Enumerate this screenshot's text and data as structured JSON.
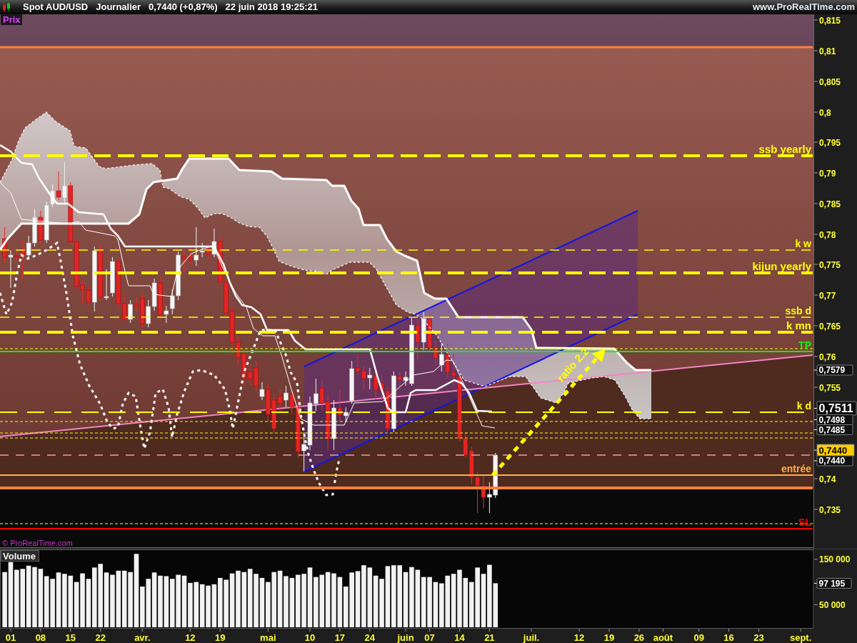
{
  "header": {
    "symbol": "Spot AUD/USD",
    "period": "Journalier",
    "quote": "0,7440 (+0,87%)",
    "timestamp": "22 juin 2018 19:25:21",
    "site": "www.ProRealTime.com"
  },
  "price_panel": {
    "title": "Prix",
    "copyright": "© ProRealTime.com",
    "arrow_label": "ratio 2.2",
    "levels": [
      {
        "label": "ssb yearly",
        "kind": "thick-dashed",
        "color": "#ffff00"
      },
      {
        "label": "k w",
        "kind": "thin-dashed",
        "color": "#ffff00"
      },
      {
        "label": "kijun yearly",
        "kind": "thick-dashed",
        "color": "#ffff00"
      },
      {
        "label": "ssb d",
        "kind": "thin-dashed",
        "color": "#ffff00"
      },
      {
        "label": "k mn",
        "kind": "thick-dashed",
        "color": "#ffff00"
      },
      {
        "label": "TP",
        "kind": "solid",
        "color": "#00ff00"
      },
      {
        "label": "k d",
        "kind": "dashed",
        "color": "#ffff00"
      },
      {
        "label": "entrée",
        "kind": "solid",
        "color": "#ffb040"
      },
      {
        "label": "SL",
        "kind": "solid",
        "color": "#ff0000"
      }
    ],
    "axis_labels": [
      "0,815",
      "0,81",
      "0,805",
      "0,8",
      "0,795",
      "0,79",
      "0,785",
      "0,78",
      "0,775",
      "0,77",
      "0,765",
      "0,76",
      "0,755",
      "0,74",
      "0,735"
    ],
    "price_tags": [
      {
        "text": "0,7579",
        "kind": "plain"
      },
      {
        "text": "0,7511",
        "kind": "large"
      },
      {
        "text": "0,7498",
        "kind": "plain"
      },
      {
        "text": "0,7485",
        "kind": "plain"
      },
      {
        "text": "0,7440",
        "kind": "current"
      },
      {
        "text": "0,7440",
        "kind": "plain"
      }
    ]
  },
  "volume_panel": {
    "last_value_tag": "97 195",
    "chart_data": {
      "type": "bar",
      "title": "Volume",
      "categories": [
        null,
        "01",
        null,
        null,
        null,
        null,
        "08",
        null,
        null,
        null,
        null,
        "15",
        null,
        null,
        null,
        null,
        "22",
        null,
        null,
        null,
        null,
        null,
        null,
        "avr.",
        null,
        null,
        null,
        null,
        null,
        null,
        null,
        "12",
        null,
        null,
        null,
        null,
        "19",
        null,
        null,
        null,
        null,
        null,
        null,
        null,
        "mai",
        null,
        null,
        null,
        null,
        null,
        null,
        "10",
        null,
        null,
        null,
        null,
        "17",
        null,
        null,
        null,
        null,
        "24",
        null,
        null,
        null,
        null,
        null,
        "juin",
        null,
        null,
        null,
        "07",
        null,
        null,
        null,
        null,
        "14",
        null,
        null,
        null,
        null,
        "21",
        null,
        null,
        null,
        null,
        null,
        null,
        "juil.",
        null,
        null,
        null,
        null,
        null,
        null,
        null,
        "12",
        null,
        null,
        null,
        null,
        "19",
        null,
        null,
        null,
        null,
        "26",
        null,
        null,
        null,
        "août",
        null,
        null,
        null,
        null,
        null,
        "09",
        null,
        null,
        null,
        null,
        "16",
        null,
        null,
        null,
        null,
        "23",
        null,
        null,
        null,
        null,
        null,
        null,
        "sept."
      ],
      "values": [
        122000,
        144000,
        127000,
        129000,
        136000,
        133000,
        129000,
        113000,
        107000,
        121000,
        118000,
        114000,
        100000,
        119000,
        107000,
        132000,
        140000,
        121000,
        116000,
        125000,
        125000,
        122000,
        162000,
        90000,
        107000,
        121000,
        114000,
        113000,
        107000,
        116000,
        114000,
        98000,
        100000,
        95000,
        92000,
        95000,
        109000,
        105000,
        119000,
        125000,
        122000,
        129000,
        118000,
        109000,
        100000,
        122000,
        125000,
        113000,
        109000,
        116000,
        118000,
        132000,
        111000,
        116000,
        122000,
        119000,
        111000,
        90000,
        121000,
        124000,
        137000,
        132000,
        114000,
        107000,
        135000,
        137000,
        137000,
        122000,
        133000,
        127000,
        111000,
        111000,
        100000,
        97000,
        114000,
        118000,
        127000,
        109000,
        100000,
        132000,
        118000,
        138000,
        97195,
        null,
        null,
        null,
        null,
        null,
        null,
        null,
        null,
        null,
        null,
        null,
        null,
        null,
        null,
        null,
        null,
        null,
        null,
        null,
        null,
        null,
        null,
        null,
        null,
        null,
        null,
        null,
        null,
        null,
        null,
        null,
        null,
        null,
        null,
        null,
        null,
        null,
        null,
        null,
        null,
        null,
        null,
        null,
        null,
        null,
        null,
        null,
        null,
        null,
        null,
        null
      ],
      "ylim": [
        0,
        172000
      ],
      "yticks": [
        {
          "value": 50000,
          "label": "50 000"
        },
        {
          "value": 150000,
          "label": "150 000"
        }
      ]
    }
  }
}
